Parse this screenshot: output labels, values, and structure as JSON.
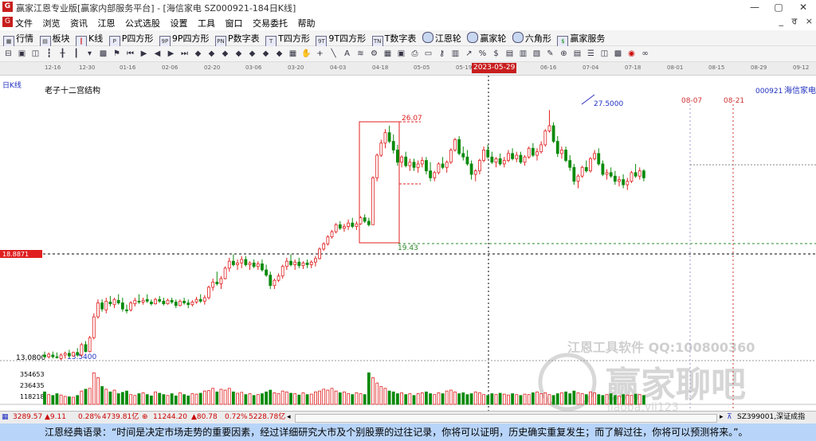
{
  "window": {
    "title": "赢家江恩专业版[赢家内部服务平台] - [海信家电  SZ000921-184日K线]"
  },
  "menu": [
    "文件",
    "浏览",
    "资讯",
    "江恩",
    "公式选股",
    "设置",
    "工具",
    "窗口",
    "交易委托",
    "帮助"
  ],
  "menu_right": [
    "_",
    "ਰ",
    "×"
  ],
  "toolbar": [
    "行情",
    "板块",
    "K线",
    "P四方形",
    "9P四方形",
    "P数字表",
    "T四方形",
    "9T四方形",
    "T数字表",
    "江恩轮",
    "赢家轮",
    "六角形",
    "赢家服务"
  ],
  "timeline": {
    "dates": [
      "12-16",
      "12-30",
      "01-16",
      "02-06",
      "02-20",
      "03-06",
      "03-20",
      "04-03",
      "04-18",
      "05-05",
      "05-19",
      "06-02",
      "06-16",
      "07-04",
      "07-18",
      "08-01",
      "08-15",
      "08-29",
      "09-12"
    ],
    "cursor_date": "2023-05-29"
  },
  "chart_labels": {
    "period": "日K线",
    "structure": "老子十二宫结构",
    "stock_code": "000921",
    "stock_name": "海信家电",
    "price_tag": "18.8871",
    "y_low": "13.0800",
    "high_label": "27.5000",
    "box_top": "26.07",
    "box_bottom": "19.43",
    "low_label": "13.5400",
    "date1": "08-07",
    "date2": "08-21",
    "vol_ticks": [
      "354653",
      "236435",
      "118218"
    ],
    "watermark1": "江恩工具软件  QQ:100800360",
    "watermark2": "赢家聊吧",
    "watermark3": "jiaoba.yjj123"
  },
  "chart_data": {
    "type": "candlestick",
    "title": "老子十二宫结构",
    "ylim": [
      13.08,
      28.2
    ],
    "series": [
      {
        "name": "海信家电 000921",
        "values": [
          [
            13.4,
            13.6,
            13.2,
            13.3
          ],
          [
            13.3,
            13.55,
            13.2,
            13.45
          ],
          [
            13.4,
            13.6,
            13.2,
            13.3
          ],
          [
            13.3,
            13.55,
            13.2,
            13.25
          ],
          [
            13.2,
            13.5,
            13.1,
            13.4
          ],
          [
            13.4,
            13.6,
            13.2,
            13.5
          ],
          [
            13.5,
            13.7,
            13.25,
            13.35
          ],
          [
            13.35,
            13.6,
            13.3,
            13.55
          ],
          [
            13.55,
            13.8,
            13.3,
            13.4
          ],
          [
            13.4,
            14.1,
            13.3,
            14.0
          ],
          [
            14.0,
            14.2,
            13.55,
            13.6
          ],
          [
            13.6,
            14.5,
            13.55,
            14.4
          ],
          [
            14.4,
            15.8,
            14.3,
            15.6
          ],
          [
            15.6,
            16.6,
            15.5,
            16.4
          ],
          [
            16.4,
            16.6,
            15.9,
            16.05
          ],
          [
            16.0,
            16.7,
            15.8,
            16.5
          ],
          [
            16.45,
            16.8,
            16.2,
            16.35
          ],
          [
            16.3,
            16.7,
            16.1,
            16.6
          ],
          [
            16.55,
            16.9,
            16.3,
            16.4
          ],
          [
            16.4,
            16.7,
            15.9,
            16.05
          ],
          [
            16.0,
            16.3,
            15.8,
            15.95
          ],
          [
            16.0,
            16.5,
            15.9,
            16.4
          ],
          [
            16.35,
            16.7,
            16.2,
            16.55
          ],
          [
            16.5,
            16.9,
            16.35,
            16.45
          ],
          [
            16.45,
            16.7,
            16.3,
            16.55
          ],
          [
            16.6,
            16.9,
            16.4,
            16.5
          ],
          [
            16.45,
            16.6,
            16.25,
            16.35
          ],
          [
            16.35,
            16.7,
            16.3,
            16.6
          ],
          [
            16.6,
            16.8,
            16.4,
            16.5
          ],
          [
            16.5,
            16.7,
            16.25,
            16.35
          ],
          [
            16.35,
            16.65,
            16.3,
            16.55
          ],
          [
            16.55,
            16.7,
            16.35,
            16.45
          ],
          [
            16.45,
            16.6,
            16.1,
            16.25
          ],
          [
            16.25,
            16.6,
            16.2,
            16.5
          ],
          [
            16.5,
            16.7,
            16.3,
            16.4
          ],
          [
            16.4,
            16.6,
            16.1,
            16.3
          ],
          [
            16.3,
            16.55,
            16.2,
            16.45
          ],
          [
            16.45,
            16.75,
            16.35,
            16.6
          ],
          [
            16.6,
            16.9,
            16.4,
            16.5
          ],
          [
            16.5,
            16.85,
            16.3,
            16.7
          ],
          [
            16.7,
            17.4,
            16.6,
            17.3
          ],
          [
            17.3,
            17.8,
            17.1,
            17.6
          ],
          [
            17.6,
            18.2,
            17.4,
            17.5
          ],
          [
            17.5,
            17.95,
            17.2,
            17.8
          ],
          [
            17.8,
            18.5,
            17.75,
            18.4
          ],
          [
            18.4,
            19.0,
            18.2,
            18.8
          ],
          [
            18.8,
            19.2,
            18.5,
            18.6
          ],
          [
            18.6,
            18.9,
            18.3,
            18.7
          ],
          [
            18.7,
            19.1,
            18.4,
            18.9
          ],
          [
            18.9,
            19.1,
            18.5,
            18.6
          ],
          [
            18.6,
            18.8,
            18.3,
            18.7
          ],
          [
            18.7,
            18.9,
            18.4,
            18.5
          ],
          [
            18.5,
            18.8,
            18.3,
            18.65
          ],
          [
            18.65,
            18.9,
            18.2,
            18.3
          ],
          [
            18.3,
            18.6,
            17.9,
            18.0
          ],
          [
            18.0,
            18.2,
            17.2,
            17.4
          ],
          [
            17.4,
            17.8,
            17.2,
            17.7
          ],
          [
            17.7,
            18.1,
            17.6,
            17.95
          ],
          [
            17.95,
            18.6,
            17.8,
            18.5
          ],
          [
            18.5,
            19.0,
            18.3,
            18.8
          ],
          [
            18.8,
            19.2,
            18.5,
            18.6
          ],
          [
            18.6,
            18.9,
            18.3,
            18.75
          ],
          [
            18.75,
            19.0,
            18.4,
            18.55
          ],
          [
            18.55,
            18.8,
            18.35,
            18.7
          ],
          [
            18.7,
            18.9,
            18.4,
            18.6
          ],
          [
            18.6,
            18.85,
            18.4,
            18.75
          ],
          [
            18.75,
            19.1,
            18.5,
            18.95
          ],
          [
            18.95,
            19.6,
            18.9,
            19.5
          ],
          [
            19.5,
            19.9,
            19.4,
            19.8
          ],
          [
            19.8,
            20.3,
            19.7,
            20.2
          ],
          [
            20.2,
            20.6,
            20.1,
            20.5
          ],
          [
            20.5,
            21.0,
            20.4,
            20.9
          ],
          [
            20.9,
            21.1,
            20.6,
            20.7
          ],
          [
            20.7,
            20.95,
            20.5,
            20.8
          ],
          [
            20.8,
            21.2,
            20.6,
            21.0
          ],
          [
            21.0,
            21.3,
            20.7,
            20.8
          ],
          [
            20.8,
            21.1,
            20.6,
            20.95
          ],
          [
            20.95,
            21.4,
            20.9,
            21.3
          ],
          [
            21.3,
            21.5,
            21.0,
            21.1
          ],
          [
            21.1,
            21.3,
            20.8,
            20.9
          ],
          [
            20.9,
            23.7,
            20.9,
            23.6
          ],
          [
            23.6,
            25.0,
            23.4,
            24.9
          ],
          [
            24.9,
            25.8,
            24.8,
            25.6
          ],
          [
            25.6,
            26.4,
            25.3,
            26.2
          ],
          [
            26.2,
            26.6,
            25.6,
            25.7
          ],
          [
            25.7,
            26.1,
            25.0,
            25.2
          ],
          [
            25.2,
            25.5,
            24.3,
            24.5
          ],
          [
            24.5,
            24.9,
            24.2,
            24.8
          ],
          [
            24.8,
            25.1,
            24.2,
            24.3
          ],
          [
            24.3,
            24.7,
            24.0,
            24.5
          ],
          [
            24.5,
            24.7,
            24.0,
            24.2
          ],
          [
            24.2,
            24.6,
            23.9,
            24.4
          ],
          [
            24.4,
            24.8,
            24.2,
            24.6
          ],
          [
            24.6,
            24.8,
            23.8,
            24.0
          ],
          [
            24.0,
            24.5,
            23.4,
            23.6
          ],
          [
            23.6,
            24.0,
            23.4,
            23.9
          ],
          [
            23.9,
            24.5,
            23.8,
            24.4
          ],
          [
            24.4,
            24.8,
            24.1,
            24.2
          ],
          [
            24.2,
            24.6,
            23.9,
            24.5
          ],
          [
            24.5,
            25.3,
            24.4,
            25.2
          ],
          [
            25.2,
            25.9,
            25.1,
            25.8
          ],
          [
            25.8,
            26.0,
            24.9,
            25.0
          ],
          [
            25.0,
            25.4,
            24.6,
            24.8
          ],
          [
            24.8,
            25.2,
            24.3,
            24.4
          ],
          [
            24.4,
            24.6,
            23.5,
            23.8
          ],
          [
            23.8,
            24.1,
            23.4,
            24.0
          ],
          [
            24.0,
            24.7,
            23.8,
            24.6
          ],
          [
            24.6,
            25.4,
            24.5,
            25.2
          ],
          [
            25.2,
            25.5,
            24.7,
            24.8
          ],
          [
            24.8,
            25.1,
            24.4,
            24.5
          ],
          [
            24.5,
            24.8,
            24.2,
            24.7
          ],
          [
            24.7,
            25.0,
            24.3,
            24.4
          ],
          [
            24.4,
            24.8,
            24.2,
            24.6
          ],
          [
            24.6,
            25.2,
            24.5,
            25.0
          ],
          [
            25.0,
            25.3,
            24.6,
            24.7
          ],
          [
            24.7,
            25.1,
            24.5,
            24.9
          ],
          [
            24.9,
            25.1,
            24.4,
            24.5
          ],
          [
            24.5,
            24.9,
            24.3,
            24.8
          ],
          [
            24.8,
            25.4,
            24.7,
            25.3
          ],
          [
            25.3,
            25.6,
            24.8,
            24.9
          ],
          [
            24.9,
            25.3,
            24.6,
            25.1
          ],
          [
            25.1,
            25.7,
            25.0,
            25.5
          ],
          [
            25.5,
            26.4,
            25.4,
            26.3
          ],
          [
            26.3,
            27.5,
            26.2,
            26.6
          ],
          [
            26.6,
            26.8,
            25.6,
            25.7
          ],
          [
            25.7,
            26.0,
            24.8,
            25.0
          ],
          [
            25.0,
            25.4,
            24.7,
            25.2
          ],
          [
            25.2,
            25.4,
            24.5,
            24.6
          ],
          [
            24.6,
            24.9,
            24.0,
            24.2
          ],
          [
            24.2,
            24.4,
            23.2,
            23.4
          ],
          [
            23.4,
            23.8,
            23.0,
            23.7
          ],
          [
            23.7,
            24.3,
            23.6,
            24.2
          ],
          [
            24.2,
            24.6,
            23.9,
            24.0
          ],
          [
            24.0,
            24.8,
            23.9,
            24.7
          ],
          [
            24.7,
            25.2,
            24.6,
            25.0
          ],
          [
            25.0,
            25.3,
            24.3,
            24.4
          ],
          [
            24.4,
            24.6,
            23.7,
            23.8
          ],
          [
            23.8,
            24.1,
            23.5,
            23.9
          ],
          [
            23.9,
            24.2,
            23.6,
            23.7
          ],
          [
            23.7,
            24.0,
            23.2,
            23.4
          ],
          [
            23.4,
            23.7,
            23.1,
            23.5
          ],
          [
            23.5,
            23.8,
            23.0,
            23.2
          ],
          [
            23.2,
            23.6,
            22.9,
            23.4
          ],
          [
            23.4,
            24.0,
            23.3,
            23.9
          ],
          [
            23.9,
            24.4,
            23.6,
            23.7
          ],
          [
            23.7,
            24.2,
            23.5,
            24.0
          ],
          [
            24.0,
            24.1,
            23.4,
            23.6
          ]
        ]
      }
    ],
    "volumes": [
      140,
      110,
      100,
      120,
      105,
      90,
      85,
      80,
      100,
      150,
      170,
      180,
      354,
      300,
      200,
      170,
      140,
      160,
      120,
      135,
      150,
      110,
      100,
      120,
      130,
      110,
      95,
      140,
      125,
      110,
      100,
      120,
      95,
      130,
      110,
      95,
      120,
      115,
      125,
      150,
      155,
      180,
      140,
      170,
      160,
      180,
      140,
      125,
      135,
      110,
      120,
      100,
      110,
      120,
      140,
      160,
      130,
      120,
      150,
      140,
      125,
      120,
      105,
      130,
      110,
      115,
      140,
      150,
      170,
      160,
      180,
      150,
      130,
      140,
      120,
      110,
      130,
      120,
      110,
      354,
      300,
      240,
      200,
      180,
      150,
      140,
      120,
      130,
      110,
      120,
      100,
      120,
      130,
      140,
      120,
      110,
      130,
      120,
      150,
      160,
      140,
      120,
      130,
      110,
      120,
      140,
      130,
      110,
      100,
      120,
      110,
      125,
      115,
      105,
      120,
      110,
      100,
      115,
      110,
      130,
      140,
      120,
      130,
      110,
      100,
      120,
      130,
      140,
      120,
      150,
      130,
      120,
      110,
      140,
      130,
      110,
      100,
      110,
      120,
      100,
      95,
      110,
      105,
      100,
      115,
      110,
      100,
      95
    ],
    "volume_ylim": [
      0,
      472870
    ]
  },
  "statusbar": {
    "idx1": "3289.57",
    "idx1_chg": "▲9.11",
    "idx1_pct": "0.28%",
    "idx1_amt": "4739.81亿",
    "idx2": "11244.20",
    "idx2_chg": "▲80.78",
    "idx2_pct": "0.72%",
    "idx2_amt": "5228.78亿",
    "right": "SZ399001,深证成指"
  },
  "quote": "江恩经典语录：“时间是决定市场走势的重要因素，经过详细研究大市及个别股票的过往记录，你将可以证明，历史确实重复发生；而了解过往，你将可以预测将来。”。"
}
